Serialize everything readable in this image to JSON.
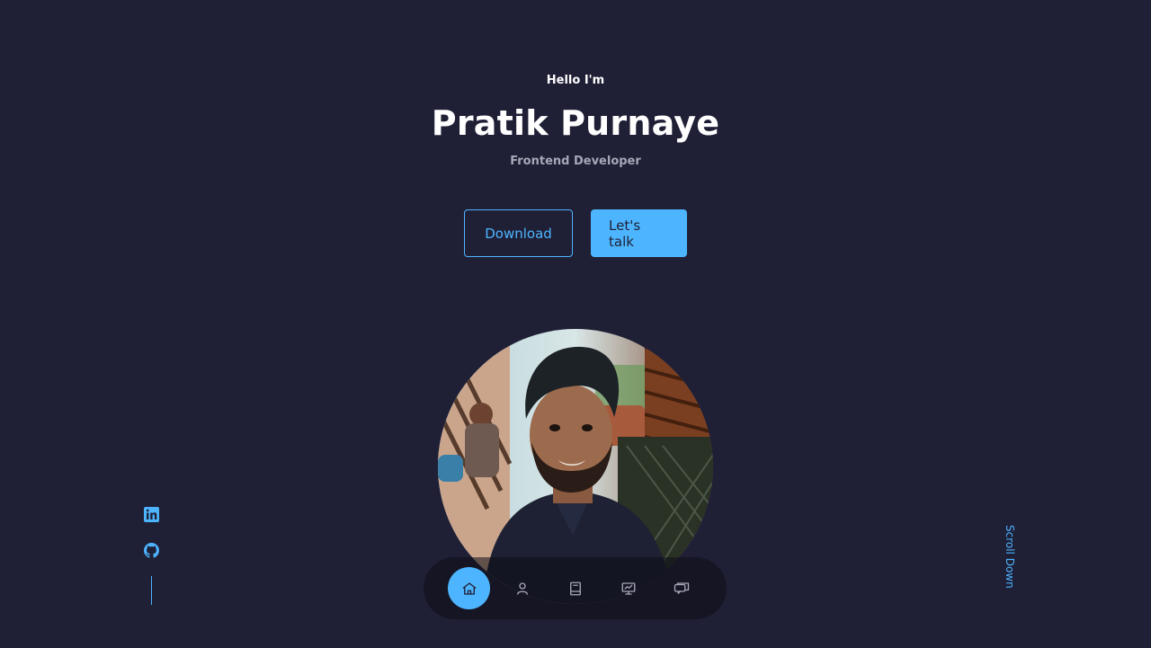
{
  "hero": {
    "greeting": "Hello I'm",
    "name": "Pratik Purnaye",
    "role": "Frontend Developer"
  },
  "cta": {
    "download_label": "Download",
    "talk_label": "Let's talk"
  },
  "scroll": {
    "label": "Scroll Down"
  },
  "socials": [
    {
      "icon": "linkedin-icon"
    },
    {
      "icon": "github-icon"
    }
  ],
  "nav": {
    "items": [
      {
        "icon": "home-icon",
        "active": true
      },
      {
        "icon": "user-icon",
        "active": false
      },
      {
        "icon": "book-icon",
        "active": false
      },
      {
        "icon": "presentation-chart-icon",
        "active": false
      },
      {
        "icon": "chat-bubbles-icon",
        "active": false
      }
    ]
  },
  "colors": {
    "background": "#1f1f36",
    "accent": "#4db5ff",
    "muted_text": "#a7a7b8",
    "nav_background": "#0c0c16"
  }
}
